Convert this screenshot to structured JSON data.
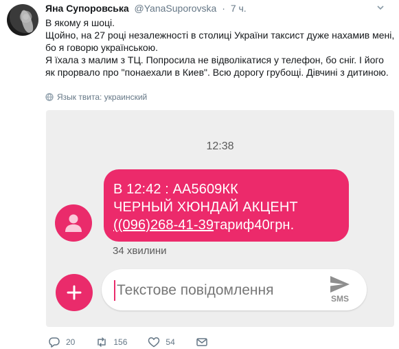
{
  "tweet": {
    "author": "Яна Супоровська",
    "handle": "@YanaSuporovska",
    "separator": "·",
    "time": "7 ч.",
    "lines": [
      "В якому я шоці.",
      "Щойно, на 27 році незалежності в столиці України таксист дуже нахамив мені, бо я говорю українською.",
      "Я їхала з малим з ТЦ. Попросила не відволікатися у телефон, бо сніг. І його як прорвало про \"понаехали в Киев\". Всю дорогу грубощі. Дівчині з дитиною."
    ],
    "language_label": "Язык твита: украинский"
  },
  "sms": {
    "time": "12:38",
    "bubble": {
      "line1": "В 12:42 : АА5609КК",
      "line2": "ЧЕРНЫЙ ХЮНДАЙ АКЦЕНТ",
      "phone": "(096)268-41-39",
      "tariff": "тариф40грн.",
      "open_paren": "("
    },
    "age": "34 хвилини",
    "compose_placeholder": "Текстове повідомлення",
    "send_label": "SMS",
    "accent": "#ea2b6b"
  },
  "actions": {
    "replies": "20",
    "retweets": "156",
    "likes": "54"
  },
  "icons": [
    "caret-down-icon",
    "globe-icon",
    "person-icon",
    "plus-icon",
    "send-icon",
    "reply-icon",
    "retweet-icon",
    "heart-icon",
    "message-icon"
  ]
}
